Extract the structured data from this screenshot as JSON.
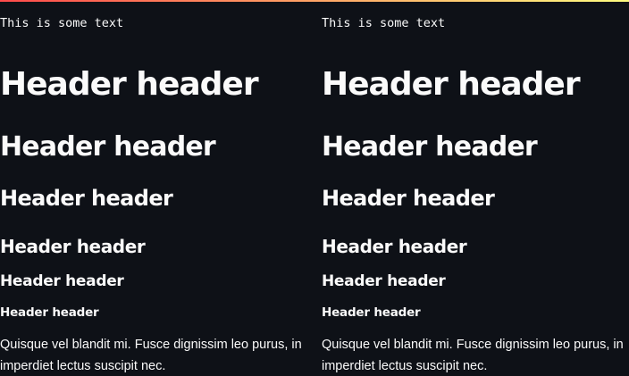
{
  "theme": {
    "background": "#0e1117",
    "text": "#fafafa",
    "accent_bar_start": "#ff4b4b",
    "accent_bar_end": "#fffd80"
  },
  "columns": [
    {
      "code_text": "This is some text",
      "headers": [
        "Header header",
        "Header header",
        "Header header",
        "Header header",
        "Header header",
        "Header header"
      ],
      "paragraph": "Quisque vel blandit mi. Fusce dignissim leo purus, in imperdiet lectus suscipit nec."
    },
    {
      "code_text": "This is some text",
      "headers": [
        "Header header",
        "Header header",
        "Header header",
        "Header header",
        "Header header",
        "Header header"
      ],
      "paragraph": "Quisque vel blandit mi. Fusce dignissim leo purus, in imperdiet lectus suscipit nec."
    }
  ]
}
